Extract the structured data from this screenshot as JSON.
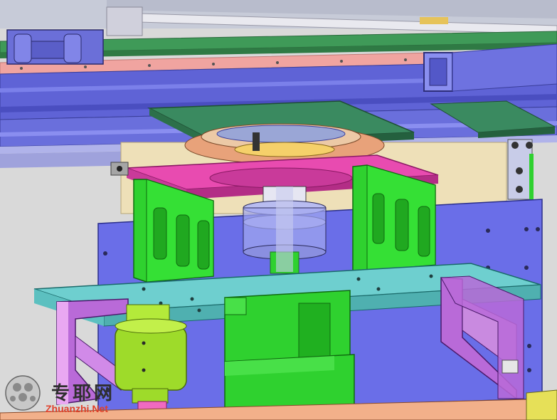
{
  "watermark": {
    "text_cn": "专耶网",
    "text_en": "Zhuanzhi.Net"
  },
  "colors": {
    "background": "#d9d9d9",
    "frame_blue": "#5f63d6",
    "rail_green": "#3f9a58",
    "rail_pink": "#f0a4a0",
    "magenta_plate": "#e84bb0",
    "green_plate": "#2fd12f",
    "cyan_plate": "#6ecfcf",
    "lime_cylinder": "#9edb2a",
    "purple_bracket": "#b96ad8",
    "tan_panel": "#eee0b8",
    "orange_flange": "#e8a27a"
  }
}
